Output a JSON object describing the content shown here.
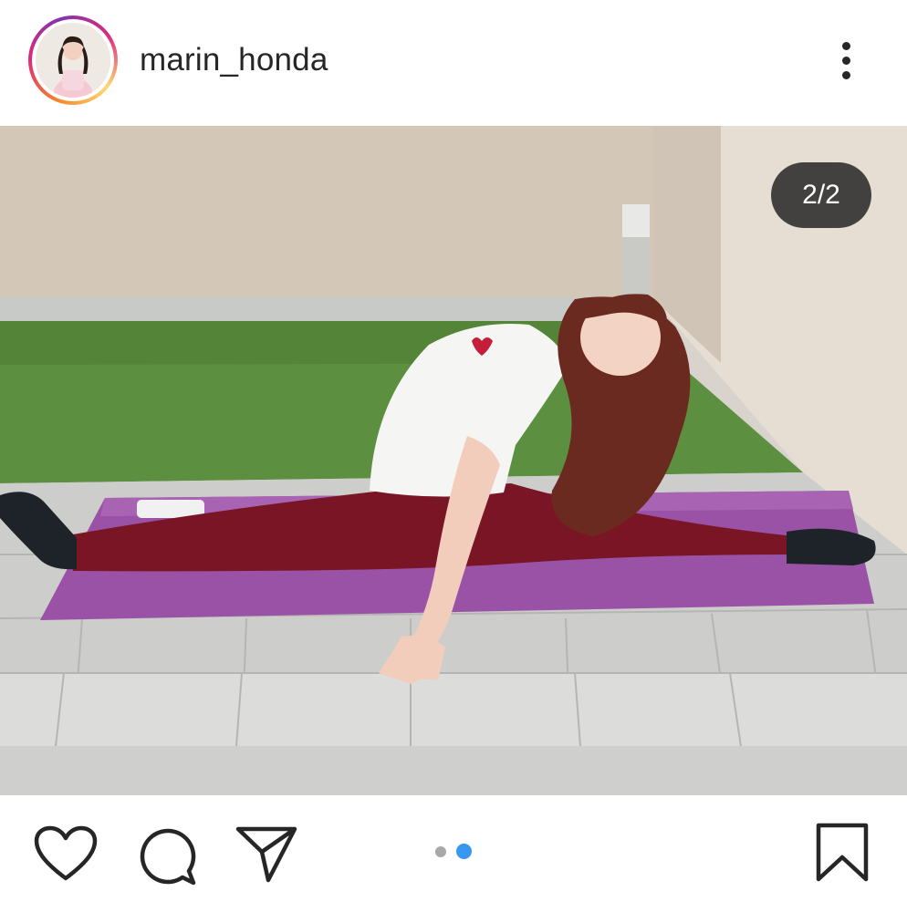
{
  "post": {
    "username": "marin_honda",
    "media_counter": "2/2",
    "carousel": {
      "total": 2,
      "active_index": 2
    }
  },
  "icons": {
    "more": "more-vertical-icon",
    "like": "heart-icon",
    "comment": "comment-bubble-icon",
    "share": "paper-plane-icon",
    "save": "bookmark-icon"
  },
  "colors": {
    "text": "#262626",
    "dot_active": "#3897f0",
    "dot_inactive": "#a8a8a8",
    "counter_bg": "#262626"
  }
}
